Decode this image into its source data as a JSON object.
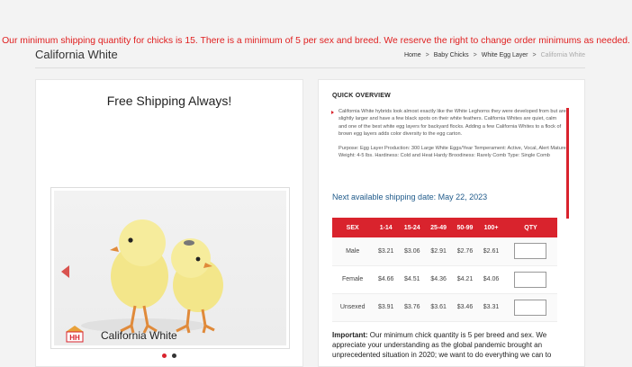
{
  "notice": "Our minimum shipping quantity for chicks is 15. There is a minimum of 5 per sex and breed. We reserve the right to change order minimums as needed.",
  "page_title": "California White",
  "breadcrumb": {
    "items": [
      "Home",
      "Baby Chicks",
      "White Egg Layer"
    ],
    "current": "California White",
    "separator": ">"
  },
  "left": {
    "free_shipping": "Free Shipping Always!",
    "caption": "California White",
    "logo_text": "HH"
  },
  "overview": {
    "title": "QUICK OVERVIEW",
    "description": "California White hybrids look almost exactly like the White Leghorns they were developed from but are slightly larger and have a few black spots on their white feathers. California Whites are quiet, calm and one of the best white egg layers for backyard flocks. Adding a few California Whites to a flock of brown egg layers adds color diversity to the egg carton.",
    "details": "Purpose: Egg Layer Production: 300 Large White Eggs/Year Temperament: Active, Vocal, Alert Mature Weight: 4-5 lbs. Hardiness: Cold and Heat Hardy Broodiness: Rarely Comb Type: Single Comb",
    "ship_date": "Next available shipping date: May 22, 2023",
    "table": {
      "headers": [
        "SEX",
        "1-14",
        "15-24",
        "25-49",
        "50-99",
        "100+",
        "QTY"
      ],
      "rows": [
        {
          "sex": "Male",
          "p1": "$3.21",
          "p2": "$3.06",
          "p3": "$2.91",
          "p4": "$2.76",
          "p5": "$2.61"
        },
        {
          "sex": "Female",
          "p1": "$4.66",
          "p2": "$4.51",
          "p3": "$4.36",
          "p4": "$4.21",
          "p5": "$4.06"
        },
        {
          "sex": "Unsexed",
          "p1": "$3.91",
          "p2": "$3.76",
          "p3": "$3.61",
          "p4": "$3.46",
          "p5": "$3.31"
        }
      ]
    },
    "important_label": "Important:",
    "important_text": "Our minimum chick quantity is 5 per breed and sex. We appreciate your understanding as the global pandemic brought an unprecedented situation in 2020; we want to do everything we can to"
  },
  "colors": {
    "accent": "#d9232d",
    "link": "#1f5a8a",
    "notice": "#e02020"
  }
}
